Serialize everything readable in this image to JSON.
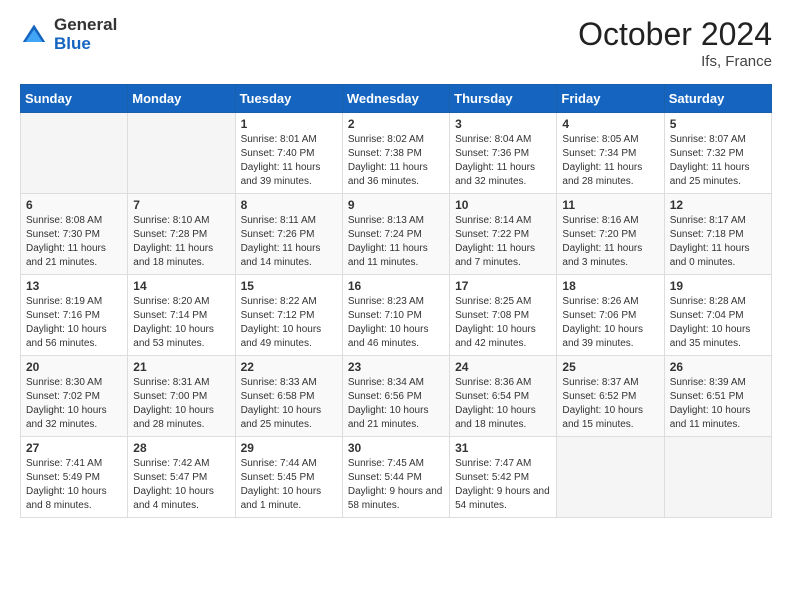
{
  "header": {
    "logo_general": "General",
    "logo_blue": "Blue",
    "title": "October 2024",
    "subtitle": "Ifs, France"
  },
  "days_of_week": [
    "Sunday",
    "Monday",
    "Tuesday",
    "Wednesday",
    "Thursday",
    "Friday",
    "Saturday"
  ],
  "weeks": [
    [
      {
        "day": "",
        "sunrise": "",
        "sunset": "",
        "daylight": ""
      },
      {
        "day": "",
        "sunrise": "",
        "sunset": "",
        "daylight": ""
      },
      {
        "day": "1",
        "sunrise": "Sunrise: 8:01 AM",
        "sunset": "Sunset: 7:40 PM",
        "daylight": "Daylight: 11 hours and 39 minutes."
      },
      {
        "day": "2",
        "sunrise": "Sunrise: 8:02 AM",
        "sunset": "Sunset: 7:38 PM",
        "daylight": "Daylight: 11 hours and 36 minutes."
      },
      {
        "day": "3",
        "sunrise": "Sunrise: 8:04 AM",
        "sunset": "Sunset: 7:36 PM",
        "daylight": "Daylight: 11 hours and 32 minutes."
      },
      {
        "day": "4",
        "sunrise": "Sunrise: 8:05 AM",
        "sunset": "Sunset: 7:34 PM",
        "daylight": "Daylight: 11 hours and 28 minutes."
      },
      {
        "day": "5",
        "sunrise": "Sunrise: 8:07 AM",
        "sunset": "Sunset: 7:32 PM",
        "daylight": "Daylight: 11 hours and 25 minutes."
      }
    ],
    [
      {
        "day": "6",
        "sunrise": "Sunrise: 8:08 AM",
        "sunset": "Sunset: 7:30 PM",
        "daylight": "Daylight: 11 hours and 21 minutes."
      },
      {
        "day": "7",
        "sunrise": "Sunrise: 8:10 AM",
        "sunset": "Sunset: 7:28 PM",
        "daylight": "Daylight: 11 hours and 18 minutes."
      },
      {
        "day": "8",
        "sunrise": "Sunrise: 8:11 AM",
        "sunset": "Sunset: 7:26 PM",
        "daylight": "Daylight: 11 hours and 14 minutes."
      },
      {
        "day": "9",
        "sunrise": "Sunrise: 8:13 AM",
        "sunset": "Sunset: 7:24 PM",
        "daylight": "Daylight: 11 hours and 11 minutes."
      },
      {
        "day": "10",
        "sunrise": "Sunrise: 8:14 AM",
        "sunset": "Sunset: 7:22 PM",
        "daylight": "Daylight: 11 hours and 7 minutes."
      },
      {
        "day": "11",
        "sunrise": "Sunrise: 8:16 AM",
        "sunset": "Sunset: 7:20 PM",
        "daylight": "Daylight: 11 hours and 3 minutes."
      },
      {
        "day": "12",
        "sunrise": "Sunrise: 8:17 AM",
        "sunset": "Sunset: 7:18 PM",
        "daylight": "Daylight: 11 hours and 0 minutes."
      }
    ],
    [
      {
        "day": "13",
        "sunrise": "Sunrise: 8:19 AM",
        "sunset": "Sunset: 7:16 PM",
        "daylight": "Daylight: 10 hours and 56 minutes."
      },
      {
        "day": "14",
        "sunrise": "Sunrise: 8:20 AM",
        "sunset": "Sunset: 7:14 PM",
        "daylight": "Daylight: 10 hours and 53 minutes."
      },
      {
        "day": "15",
        "sunrise": "Sunrise: 8:22 AM",
        "sunset": "Sunset: 7:12 PM",
        "daylight": "Daylight: 10 hours and 49 minutes."
      },
      {
        "day": "16",
        "sunrise": "Sunrise: 8:23 AM",
        "sunset": "Sunset: 7:10 PM",
        "daylight": "Daylight: 10 hours and 46 minutes."
      },
      {
        "day": "17",
        "sunrise": "Sunrise: 8:25 AM",
        "sunset": "Sunset: 7:08 PM",
        "daylight": "Daylight: 10 hours and 42 minutes."
      },
      {
        "day": "18",
        "sunrise": "Sunrise: 8:26 AM",
        "sunset": "Sunset: 7:06 PM",
        "daylight": "Daylight: 10 hours and 39 minutes."
      },
      {
        "day": "19",
        "sunrise": "Sunrise: 8:28 AM",
        "sunset": "Sunset: 7:04 PM",
        "daylight": "Daylight: 10 hours and 35 minutes."
      }
    ],
    [
      {
        "day": "20",
        "sunrise": "Sunrise: 8:30 AM",
        "sunset": "Sunset: 7:02 PM",
        "daylight": "Daylight: 10 hours and 32 minutes."
      },
      {
        "day": "21",
        "sunrise": "Sunrise: 8:31 AM",
        "sunset": "Sunset: 7:00 PM",
        "daylight": "Daylight: 10 hours and 28 minutes."
      },
      {
        "day": "22",
        "sunrise": "Sunrise: 8:33 AM",
        "sunset": "Sunset: 6:58 PM",
        "daylight": "Daylight: 10 hours and 25 minutes."
      },
      {
        "day": "23",
        "sunrise": "Sunrise: 8:34 AM",
        "sunset": "Sunset: 6:56 PM",
        "daylight": "Daylight: 10 hours and 21 minutes."
      },
      {
        "day": "24",
        "sunrise": "Sunrise: 8:36 AM",
        "sunset": "Sunset: 6:54 PM",
        "daylight": "Daylight: 10 hours and 18 minutes."
      },
      {
        "day": "25",
        "sunrise": "Sunrise: 8:37 AM",
        "sunset": "Sunset: 6:52 PM",
        "daylight": "Daylight: 10 hours and 15 minutes."
      },
      {
        "day": "26",
        "sunrise": "Sunrise: 8:39 AM",
        "sunset": "Sunset: 6:51 PM",
        "daylight": "Daylight: 10 hours and 11 minutes."
      }
    ],
    [
      {
        "day": "27",
        "sunrise": "Sunrise: 7:41 AM",
        "sunset": "Sunset: 5:49 PM",
        "daylight": "Daylight: 10 hours and 8 minutes."
      },
      {
        "day": "28",
        "sunrise": "Sunrise: 7:42 AM",
        "sunset": "Sunset: 5:47 PM",
        "daylight": "Daylight: 10 hours and 4 minutes."
      },
      {
        "day": "29",
        "sunrise": "Sunrise: 7:44 AM",
        "sunset": "Sunset: 5:45 PM",
        "daylight": "Daylight: 10 hours and 1 minute."
      },
      {
        "day": "30",
        "sunrise": "Sunrise: 7:45 AM",
        "sunset": "Sunset: 5:44 PM",
        "daylight": "Daylight: 9 hours and 58 minutes."
      },
      {
        "day": "31",
        "sunrise": "Sunrise: 7:47 AM",
        "sunset": "Sunset: 5:42 PM",
        "daylight": "Daylight: 9 hours and 54 minutes."
      },
      {
        "day": "",
        "sunrise": "",
        "sunset": "",
        "daylight": ""
      },
      {
        "day": "",
        "sunrise": "",
        "sunset": "",
        "daylight": ""
      }
    ]
  ]
}
